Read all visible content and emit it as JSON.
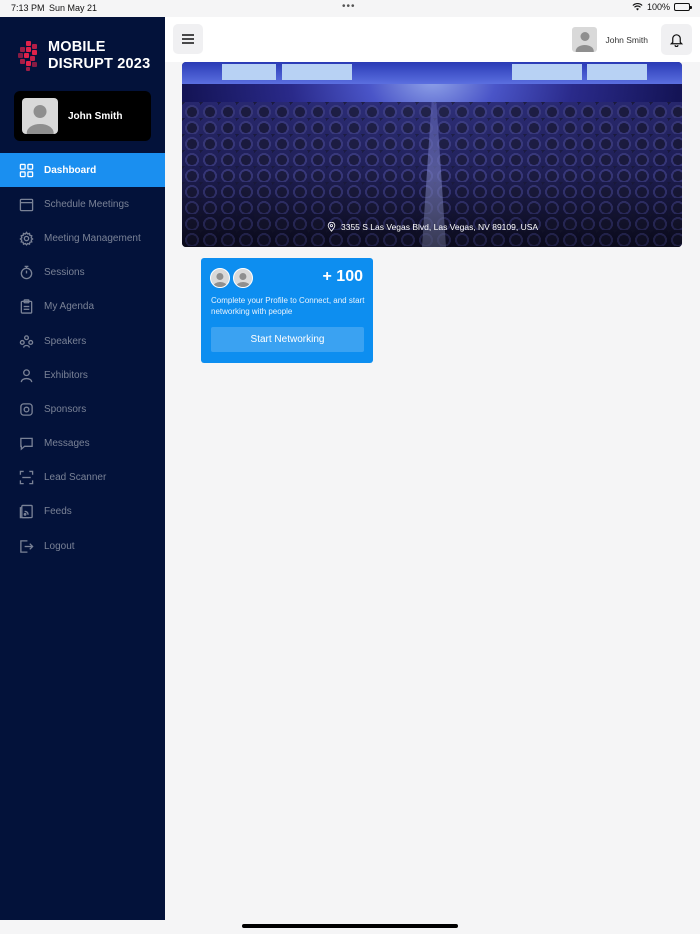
{
  "status_bar": {
    "time": "7:13 PM",
    "date": "Sun May 21",
    "dots": "•••",
    "battery": "100%"
  },
  "brand": {
    "line1": "MOBILE",
    "line2": "DISRUPT 2023",
    "accent": "#e0224b"
  },
  "profile": {
    "name": "John Smith"
  },
  "nav": {
    "items": [
      {
        "label": "Dashboard",
        "icon": "grid-icon",
        "active": true
      },
      {
        "label": "Schedule Meetings",
        "icon": "calendar-icon"
      },
      {
        "label": "Meeting Management",
        "icon": "gear-icon"
      },
      {
        "label": "Sessions",
        "icon": "stopwatch-icon"
      },
      {
        "label": "My Agenda",
        "icon": "clipboard-icon"
      },
      {
        "label": "Speakers",
        "icon": "speakers-icon"
      },
      {
        "label": "Exhibitors",
        "icon": "person-icon"
      },
      {
        "label": "Sponsors",
        "icon": "sponsor-icon"
      },
      {
        "label": "Messages",
        "icon": "chat-icon"
      },
      {
        "label": "Lead Scanner",
        "icon": "scanner-icon"
      },
      {
        "label": "Feeds",
        "icon": "feeds-icon"
      },
      {
        "label": "Logout",
        "icon": "logout-icon"
      }
    ]
  },
  "header": {
    "user_name": "John Smith"
  },
  "banner": {
    "location": "3355 S Las Vegas Blvd, Las Vegas, NV 89109, USA"
  },
  "networking": {
    "count": "+ 100",
    "description": "Complete your Profile to Connect, and start networking with people",
    "button": "Start Networking"
  },
  "colors": {
    "sidebar": "#03123a",
    "accent": "#1a8ff0",
    "card": "#0d8ef0"
  }
}
